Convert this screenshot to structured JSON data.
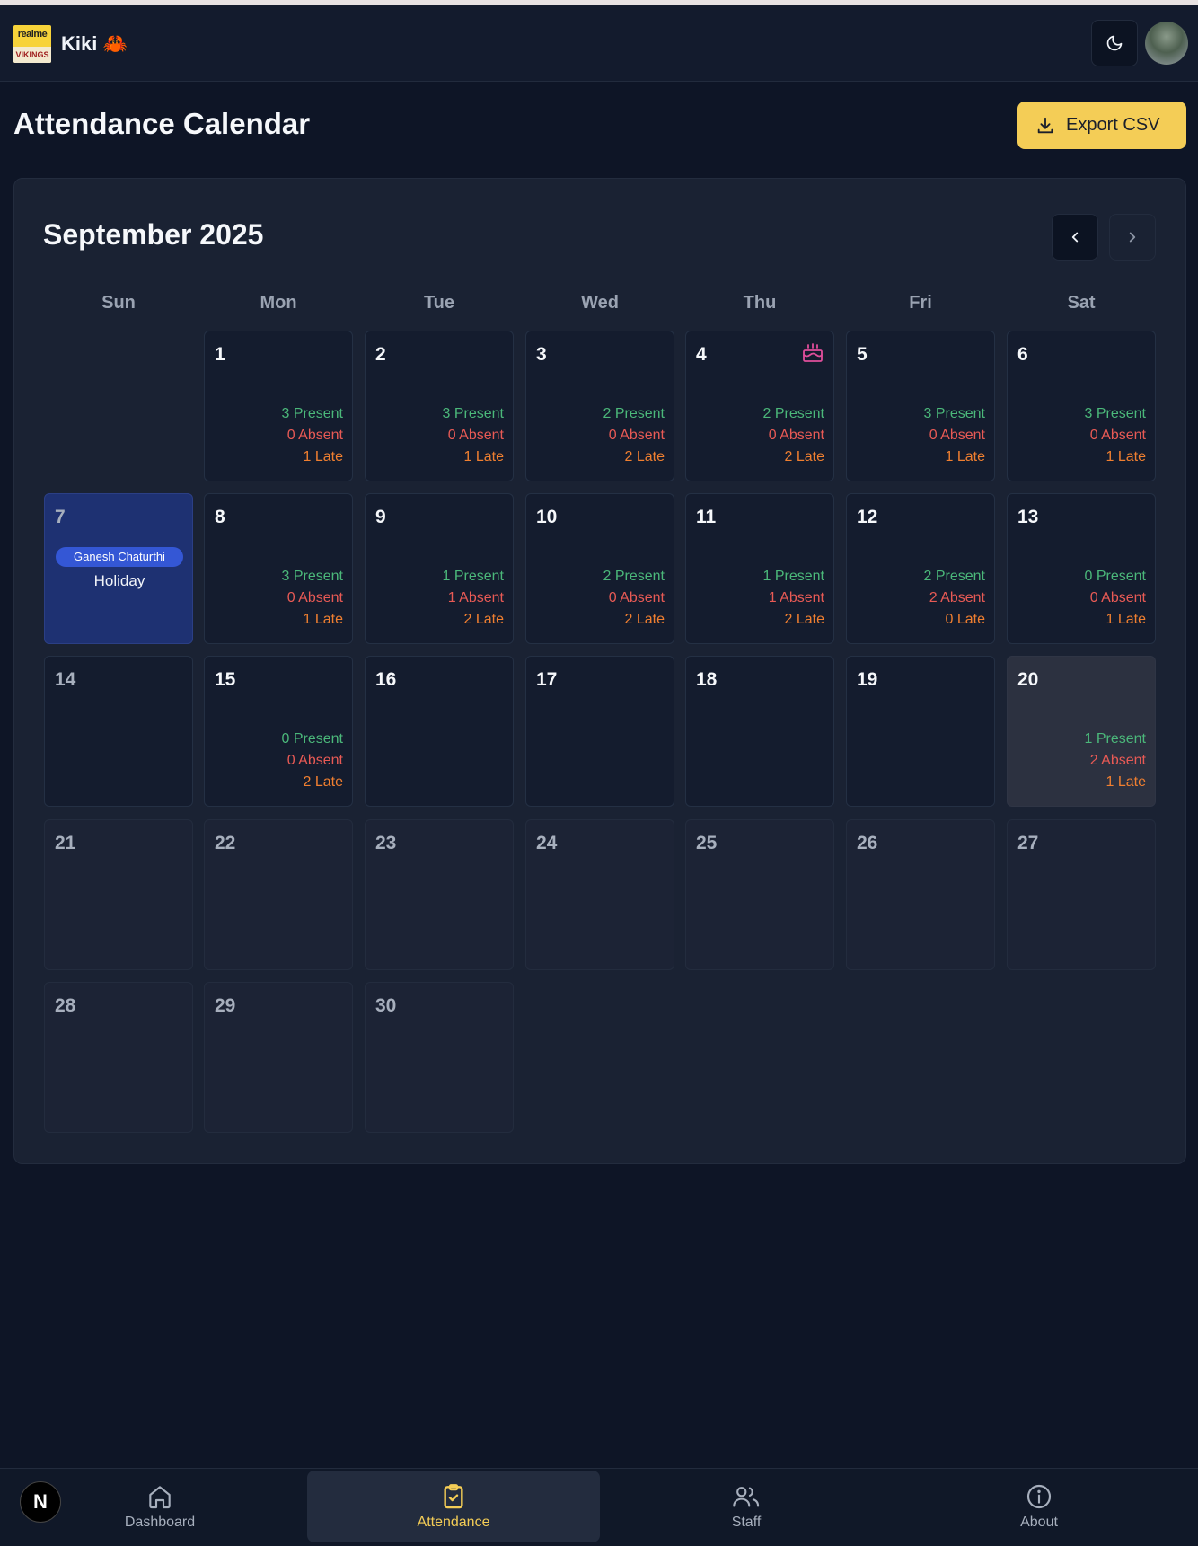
{
  "header": {
    "logo_text_top": "realme",
    "logo_text_bottom": "VIKINGS",
    "app_title": "Kiki 🦀",
    "theme_toggle_icon": "moon-icon",
    "avatar_icon": "user-avatar"
  },
  "page": {
    "title": "Attendance Calendar",
    "export_label": "Export CSV",
    "export_icon": "download-icon"
  },
  "calendar": {
    "month_label": "September 2025",
    "prev_icon": "chevron-left-icon",
    "next_icon": "chevron-right-icon",
    "weekdays": [
      "Sun",
      "Mon",
      "Tue",
      "Wed",
      "Thu",
      "Fri",
      "Sat"
    ],
    "days": [
      {
        "day": "1",
        "present": "3 Present",
        "absent": "0 Absent",
        "late": "1 Late"
      },
      {
        "day": "2",
        "present": "3 Present",
        "absent": "0 Absent",
        "late": "1 Late"
      },
      {
        "day": "3",
        "present": "2 Present",
        "absent": "0 Absent",
        "late": "2 Late"
      },
      {
        "day": "4",
        "present": "2 Present",
        "absent": "0 Absent",
        "late": "2 Late",
        "icon": "birthday-cake-icon"
      },
      {
        "day": "5",
        "present": "3 Present",
        "absent": "0 Absent",
        "late": "1 Late"
      },
      {
        "day": "6",
        "present": "3 Present",
        "absent": "0 Absent",
        "late": "1 Late"
      },
      {
        "day": "7",
        "holiday_name": "Ganesh Chaturthi",
        "holiday_label": "Holiday"
      },
      {
        "day": "8",
        "present": "3 Present",
        "absent": "0 Absent",
        "late": "1 Late"
      },
      {
        "day": "9",
        "present": "1 Present",
        "absent": "1 Absent",
        "late": "2 Late"
      },
      {
        "day": "10",
        "present": "2 Present",
        "absent": "0 Absent",
        "late": "2 Late"
      },
      {
        "day": "11",
        "present": "1 Present",
        "absent": "1 Absent",
        "late": "2 Late"
      },
      {
        "day": "12",
        "present": "2 Present",
        "absent": "2 Absent",
        "late": "0 Late"
      },
      {
        "day": "13",
        "present": "0 Present",
        "absent": "0 Absent",
        "late": "1 Late"
      },
      {
        "day": "14"
      },
      {
        "day": "15",
        "present": "0 Present",
        "absent": "0 Absent",
        "late": "2 Late"
      },
      {
        "day": "16"
      },
      {
        "day": "17"
      },
      {
        "day": "18"
      },
      {
        "day": "19"
      },
      {
        "day": "20",
        "present": "1 Present",
        "absent": "2 Absent",
        "late": "1 Late",
        "today": true
      },
      {
        "day": "21"
      },
      {
        "day": "22"
      },
      {
        "day": "23"
      },
      {
        "day": "24"
      },
      {
        "day": "25"
      },
      {
        "day": "26"
      },
      {
        "day": "27"
      },
      {
        "day": "28"
      },
      {
        "day": "29"
      },
      {
        "day": "30"
      }
    ]
  },
  "bottom_nav": {
    "badge": "N",
    "items": [
      {
        "label": "Dashboard",
        "icon": "home-icon"
      },
      {
        "label": "Attendance",
        "icon": "clipboard-check-icon",
        "active": true
      },
      {
        "label": "Staff",
        "icon": "users-icon"
      },
      {
        "label": "About",
        "icon": "info-icon"
      }
    ]
  },
  "colors": {
    "accent": "#f4cd56",
    "present": "#4bb87a",
    "absent": "#e85a55",
    "late": "#f07f30",
    "holiday": "#1e3172",
    "badge": "#3457d5"
  }
}
